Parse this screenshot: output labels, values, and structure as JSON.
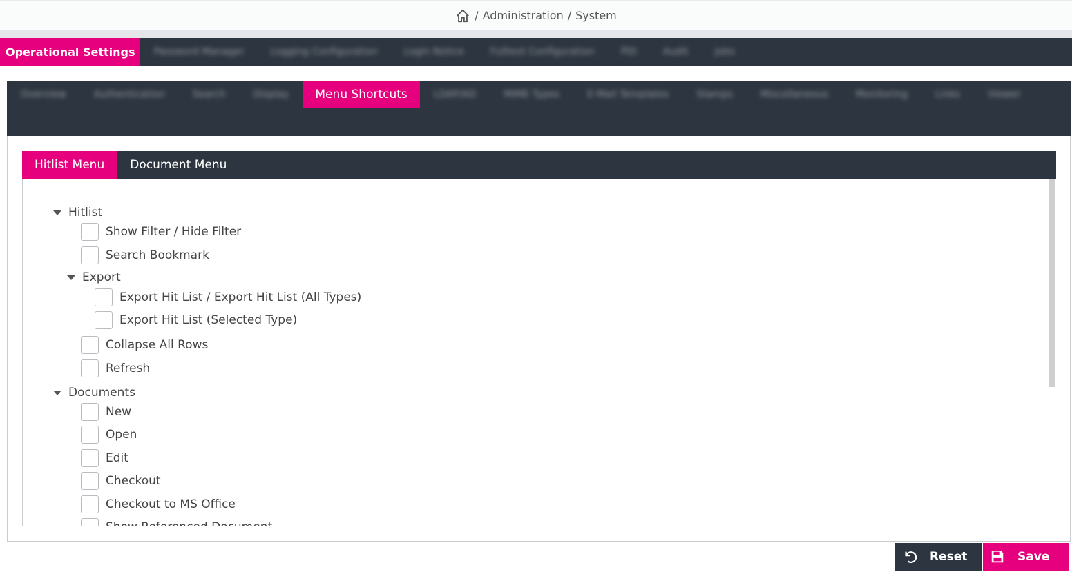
{
  "breadcrumb": {
    "icon": "home-icon",
    "items": [
      "Administration",
      "System"
    ],
    "separator": "/"
  },
  "top_tabs": [
    {
      "label": "Operational Settings",
      "active": true
    },
    {
      "label": "Password Manager",
      "active": false
    },
    {
      "label": "Logging Configuration",
      "active": false
    },
    {
      "label": "Login Notice",
      "active": false
    },
    {
      "label": "Fulltext Configuration",
      "active": false
    },
    {
      "label": "PDI",
      "active": false
    },
    {
      "label": "Audit",
      "active": false
    },
    {
      "label": "Jobs",
      "active": false
    }
  ],
  "second_tabs": [
    {
      "label": "Overview",
      "active": false
    },
    {
      "label": "Authentication",
      "active": false
    },
    {
      "label": "Search",
      "active": false
    },
    {
      "label": "Display",
      "active": false
    },
    {
      "label": "Menu Shortcuts",
      "active": true
    },
    {
      "label": "LDAP/AD",
      "active": false
    },
    {
      "label": "MIME Types",
      "active": false
    },
    {
      "label": "E-Mail Templates",
      "active": false
    },
    {
      "label": "Stamps",
      "active": false
    },
    {
      "label": "Miscellaneous",
      "active": false
    },
    {
      "label": "Monitoring",
      "active": false
    },
    {
      "label": "Links",
      "active": false
    },
    {
      "label": "Viewer",
      "active": false
    }
  ],
  "sub_tabs": [
    {
      "label": "Hitlist Menu",
      "active": true
    },
    {
      "label": "Document Menu",
      "active": false
    }
  ],
  "tree": {
    "hitlist": {
      "label": "Hitlist",
      "items": [
        "Show Filter / Hide Filter",
        "Search Bookmark"
      ],
      "export": {
        "label": "Export",
        "items": [
          "Export Hit List / Export Hit List (All Types)",
          "Export Hit List (Selected Type)"
        ]
      },
      "items_after": [
        "Collapse All Rows",
        "Refresh"
      ]
    },
    "documents": {
      "label": "Documents",
      "items": [
        "New",
        "Open",
        "Edit",
        "Checkout",
        "Checkout to MS Office",
        "Show Referenced Document"
      ]
    }
  },
  "buttons": {
    "reset": {
      "label": "Reset",
      "icon": "undo-icon"
    },
    "save": {
      "label": "Save",
      "icon": "floppy-disk-icon"
    }
  },
  "colors": {
    "accent": "#e6007e",
    "dark_bar": "#2d3540"
  }
}
